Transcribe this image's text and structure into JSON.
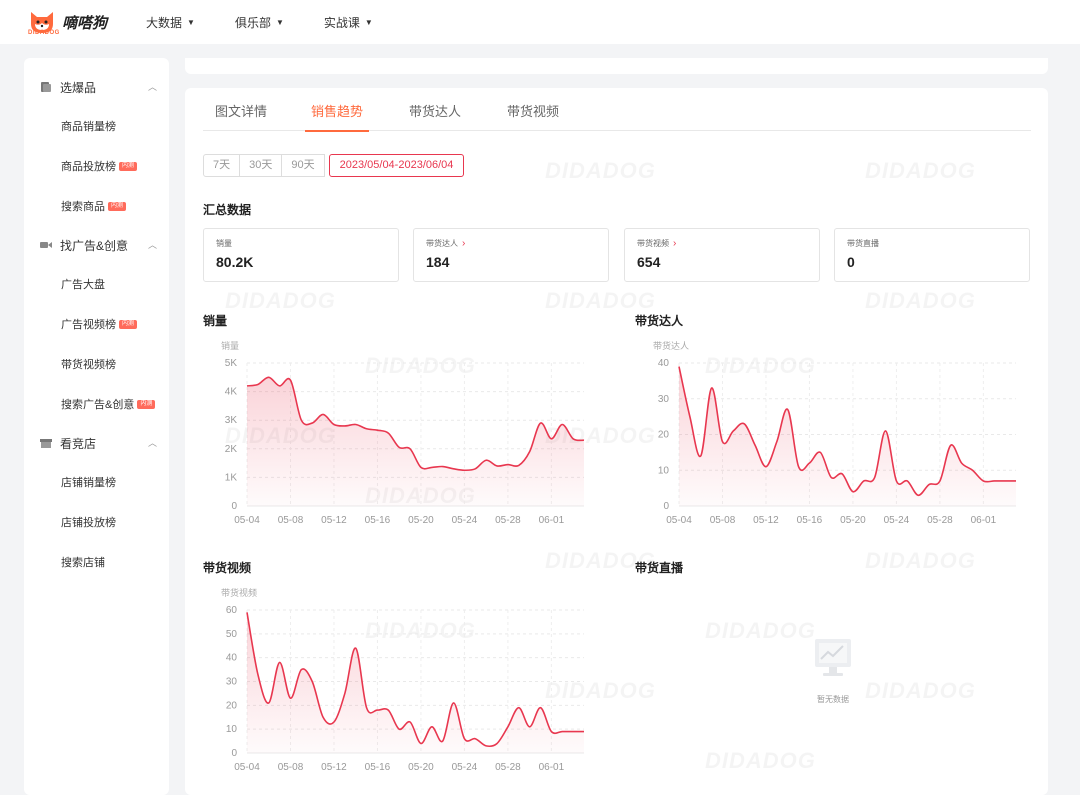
{
  "brand": {
    "name": "嘀嗒狗",
    "sub": "DIDADOG"
  },
  "topnav": [
    {
      "label": "大数据"
    },
    {
      "label": "俱乐部"
    },
    {
      "label": "实战课"
    }
  ],
  "sidebar": {
    "groups": [
      {
        "label": "选爆品",
        "items": [
          {
            "label": "商品销量榜",
            "badge": ""
          },
          {
            "label": "商品投放榜",
            "badge": "内测"
          },
          {
            "label": "搜索商品",
            "badge": "内测"
          }
        ]
      },
      {
        "label": "找广告&创意",
        "items": [
          {
            "label": "广告大盘",
            "badge": ""
          },
          {
            "label": "广告视频榜",
            "badge": "内测"
          },
          {
            "label": "带货视频榜",
            "badge": ""
          },
          {
            "label": "搜索广告&创意",
            "badge": "内测"
          }
        ]
      },
      {
        "label": "看竞店",
        "items": [
          {
            "label": "店铺销量榜",
            "badge": ""
          },
          {
            "label": "店铺投放榜",
            "badge": ""
          },
          {
            "label": "搜索店铺",
            "badge": ""
          }
        ]
      }
    ]
  },
  "watermark": "DIDADOG",
  "tabs": [
    "图文详情",
    "销售趋势",
    "带货达人",
    "带货视频"
  ],
  "active_tab": 1,
  "ranges": [
    "7天",
    "30天",
    "90天",
    "2023/05/04-2023/06/04"
  ],
  "summary_title": "汇总数据",
  "stats": [
    {
      "label": "销量",
      "value": "80.2K",
      "link": false
    },
    {
      "label": "带货达人",
      "value": "184",
      "link": true
    },
    {
      "label": "带货视频",
      "value": "654",
      "link": true
    },
    {
      "label": "带货直播",
      "value": "0",
      "link": false
    }
  ],
  "chart_titles": {
    "sales": "销量",
    "creators": "带货达人",
    "videos": "带货视频",
    "live": "带货直播"
  },
  "empty_text": "暂无数据",
  "colors": {
    "accent": "#ff6a3d",
    "line": "#e8374f"
  },
  "chart_data": [
    {
      "type": "area",
      "title": "销量",
      "ylabel": "销量",
      "x": [
        "05-04",
        "05-05",
        "05-06",
        "05-07",
        "05-08",
        "05-09",
        "05-10",
        "05-11",
        "05-12",
        "05-13",
        "05-14",
        "05-15",
        "05-16",
        "05-17",
        "05-18",
        "05-19",
        "05-20",
        "05-21",
        "05-22",
        "05-23",
        "05-24",
        "05-25",
        "05-26",
        "05-27",
        "05-28",
        "05-29",
        "05-30",
        "05-31",
        "06-01",
        "06-02",
        "06-03",
        "06-04"
      ],
      "xticks": [
        "05-04",
        "05-08",
        "05-12",
        "05-16",
        "05-20",
        "05-24",
        "05-28",
        "06-01"
      ],
      "yticks": [
        "0",
        "1K",
        "2K",
        "3K",
        "4K",
        "5K"
      ],
      "ylim": [
        0,
        5000
      ],
      "series": [
        {
          "values": [
            4200,
            4250,
            4500,
            4200,
            4400,
            3000,
            2900,
            3200,
            2850,
            2800,
            2850,
            2700,
            2650,
            2550,
            2050,
            2000,
            1350,
            1350,
            1380,
            1300,
            1250,
            1300,
            1600,
            1400,
            1450,
            1420,
            1900,
            2900,
            2350,
            2850,
            2350,
            2300
          ]
        }
      ]
    },
    {
      "type": "area",
      "title": "带货达人",
      "ylabel": "带货达人",
      "x": [
        "05-04",
        "05-05",
        "05-06",
        "05-07",
        "05-08",
        "05-09",
        "05-10",
        "05-11",
        "05-12",
        "05-13",
        "05-14",
        "05-15",
        "05-16",
        "05-17",
        "05-18",
        "05-19",
        "05-20",
        "05-21",
        "05-22",
        "05-23",
        "05-24",
        "05-25",
        "05-26",
        "05-27",
        "05-28",
        "05-29",
        "05-30",
        "05-31",
        "06-01",
        "06-02",
        "06-03",
        "06-04"
      ],
      "xticks": [
        "05-04",
        "05-08",
        "05-12",
        "05-16",
        "05-20",
        "05-24",
        "05-28",
        "06-01"
      ],
      "yticks": [
        "0",
        "10",
        "20",
        "30",
        "40"
      ],
      "ylim": [
        0,
        40
      ],
      "series": [
        {
          "values": [
            39,
            25,
            14,
            33,
            18,
            21,
            23,
            17,
            11,
            18,
            27,
            11,
            12,
            15,
            8,
            9,
            4,
            7,
            8,
            21,
            7,
            7,
            3,
            6,
            7,
            17,
            12,
            10,
            7,
            7,
            7,
            7
          ]
        }
      ]
    },
    {
      "type": "area",
      "title": "带货视频",
      "ylabel": "带货视频",
      "x": [
        "05-04",
        "05-05",
        "05-06",
        "05-07",
        "05-08",
        "05-09",
        "05-10",
        "05-11",
        "05-12",
        "05-13",
        "05-14",
        "05-15",
        "05-16",
        "05-17",
        "05-18",
        "05-19",
        "05-20",
        "05-21",
        "05-22",
        "05-23",
        "05-24",
        "05-25",
        "05-26",
        "05-27",
        "05-28",
        "05-29",
        "05-30",
        "05-31",
        "06-01",
        "06-02",
        "06-03",
        "06-04"
      ],
      "xticks": [
        "05-04",
        "05-08",
        "05-12",
        "05-16",
        "05-20",
        "05-24",
        "05-28",
        "06-01"
      ],
      "yticks": [
        "0",
        "10",
        "20",
        "30",
        "40",
        "50",
        "60"
      ],
      "ylim": [
        0,
        60
      ],
      "series": [
        {
          "values": [
            59,
            33,
            21,
            38,
            23,
            35,
            30,
            15,
            13,
            25,
            44,
            19,
            18,
            18,
            10,
            13,
            4,
            11,
            5,
            21,
            6,
            6,
            3,
            4,
            11,
            19,
            11,
            19,
            9,
            9,
            9,
            9
          ]
        }
      ]
    }
  ]
}
